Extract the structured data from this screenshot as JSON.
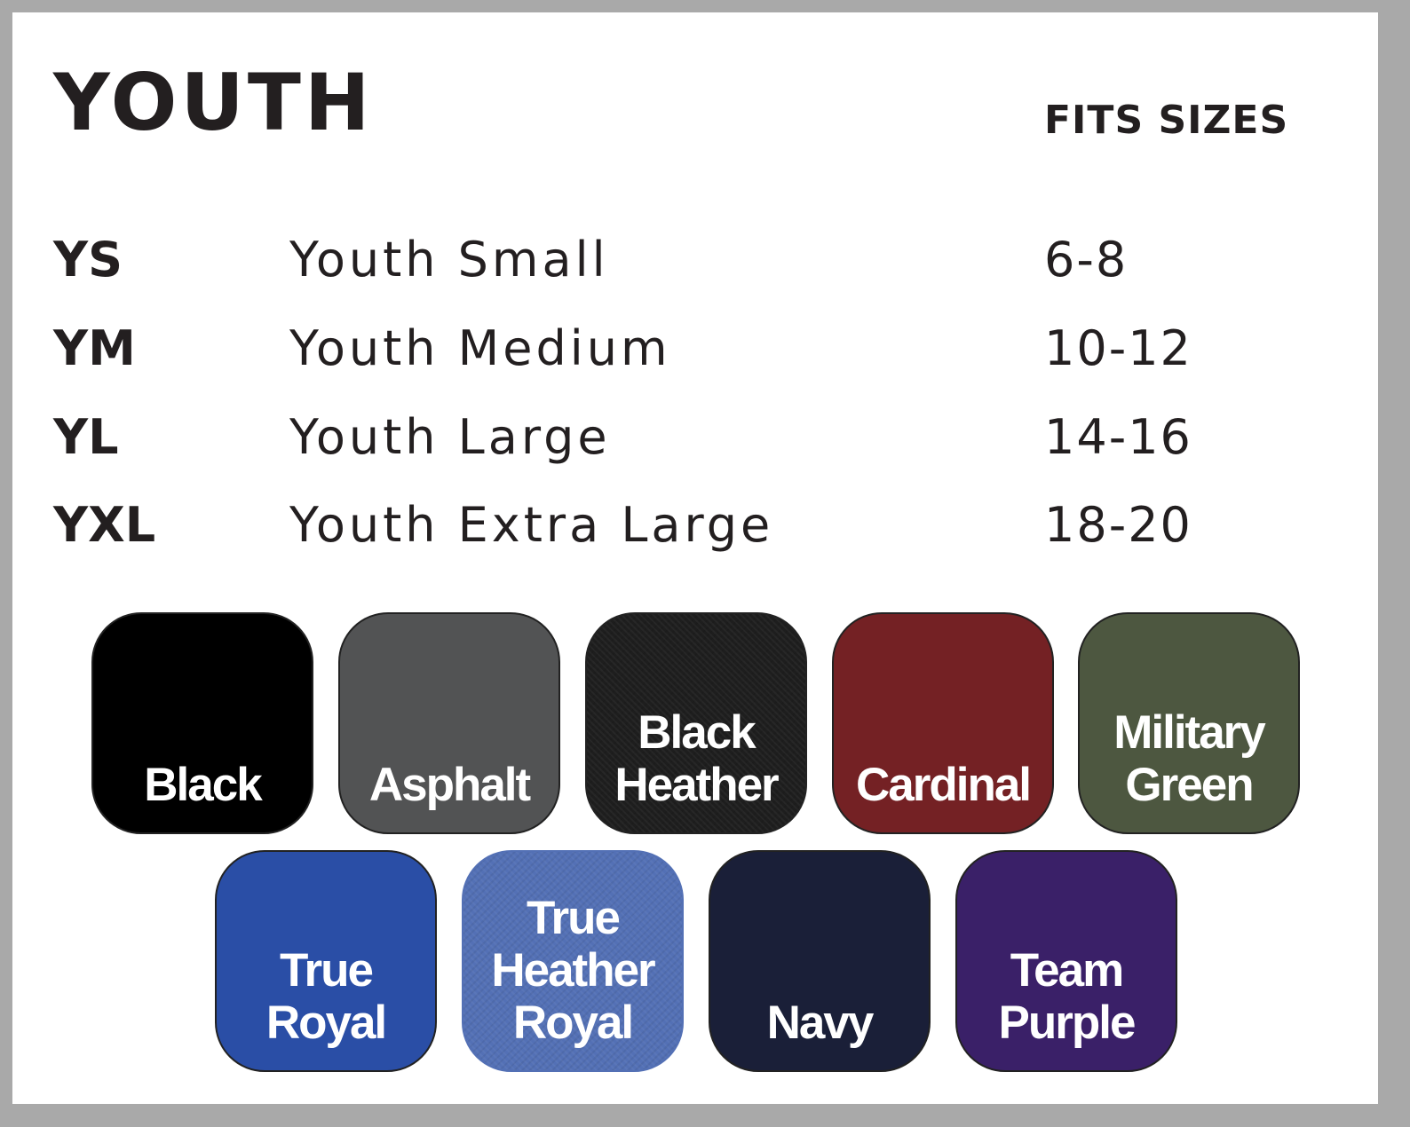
{
  "header": {
    "title": "YOUTH",
    "fits_label": "FITS SIZES"
  },
  "sizes": [
    {
      "code": "YS",
      "name": "Youth Small",
      "fits": "6-8"
    },
    {
      "code": "YM",
      "name": "Youth Medium",
      "fits": "10-12"
    },
    {
      "code": "YL",
      "name": "Youth Large",
      "fits": "14-16"
    },
    {
      "code": "YXL",
      "name": "Youth Extra Large",
      "fits": "18-20"
    }
  ],
  "colors": [
    {
      "label": "Black",
      "hex": "#000000"
    },
    {
      "label": "Asphalt",
      "hex": "#525354"
    },
    {
      "label": "Black\nHeather",
      "hex": "#1e1e1e"
    },
    {
      "label": "Cardinal",
      "hex": "#742124"
    },
    {
      "label": "Military\nGreen",
      "hex": "#4d5740"
    },
    {
      "label": "True\nRoyal",
      "hex": "#2a4ea6"
    },
    {
      "label": "True\nHeather\nRoyal",
      "hex": "#5370b5"
    },
    {
      "label": "Navy",
      "hex": "#1a1f38"
    },
    {
      "label": "Team\nPurple",
      "hex": "#3a2068"
    }
  ]
}
